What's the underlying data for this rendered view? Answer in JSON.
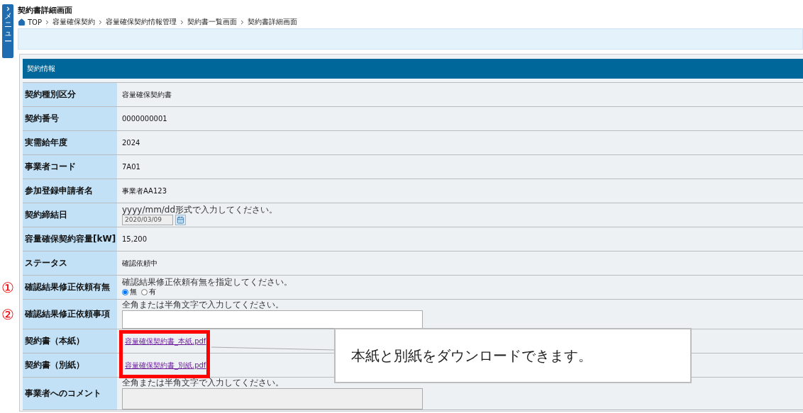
{
  "menu_tab": {
    "label": "メニュー"
  },
  "page_title": "契約書詳細画面",
  "breadcrumb": [
    "TOP",
    "容量確保契約",
    "容量確保契約情報管理",
    "契約書一覧画面",
    "契約書詳細画面"
  ],
  "section": {
    "title": "契約情報"
  },
  "rows": [
    {
      "kind": "text",
      "label": "契約種別区分",
      "value": "容量確保契約書"
    },
    {
      "kind": "text",
      "label": "契約番号",
      "value": "0000000001"
    },
    {
      "kind": "text",
      "label": "実需給年度",
      "value": "2024"
    },
    {
      "kind": "text",
      "label": "事業者コード",
      "value": "7A01"
    },
    {
      "kind": "text",
      "label": "参加登録申請者名",
      "value": "事業者AA123"
    },
    {
      "kind": "date",
      "label": "契約締結日",
      "hint": "yyyy/mm/dd形式で入力してください。",
      "value": "2020/03/09"
    },
    {
      "kind": "text",
      "label": "容量確保契約容量[kW]",
      "value": "15,200"
    },
    {
      "kind": "text",
      "label": "ステータス",
      "value": "確認依頼中"
    },
    {
      "kind": "radio",
      "label": "確認結果修正依頼有無",
      "marker": "①",
      "hint": "確認結果修正依頼有無を指定してください。",
      "options": [
        {
          "label": "無",
          "selected": true
        },
        {
          "label": "有",
          "selected": false
        }
      ]
    },
    {
      "kind": "textarea",
      "label": "確認結果修正依頼事項",
      "marker": "②",
      "hint": "全角または半角文字で入力してください。",
      "disabled": false
    },
    {
      "kind": "link",
      "label": "契約書（本紙）",
      "value": "容量確保契約書_本紙.pdf"
    },
    {
      "kind": "link",
      "label": "契約書（別紙）",
      "value": "容量確保契約書_別紙.pdf"
    },
    {
      "kind": "textarea",
      "label": "事業者へのコメント",
      "hint": "全角または半角文字で入力してください。",
      "disabled": true
    }
  ],
  "callout": {
    "text": "本紙と別紙をダウンロードできます。"
  }
}
